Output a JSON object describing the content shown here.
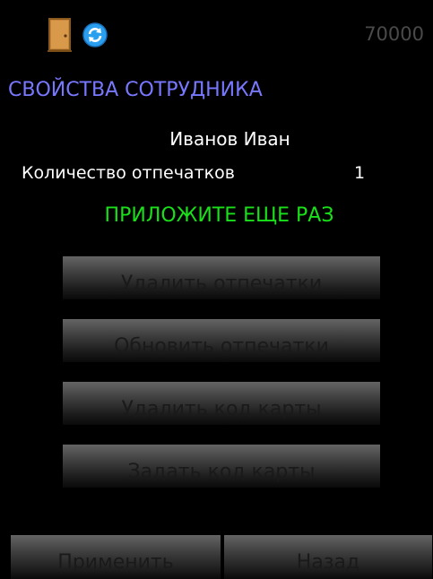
{
  "header": {
    "icons": [
      "door-icon",
      "sync-icon"
    ],
    "counter": "70000"
  },
  "title": "СВОЙСТВА СОТРУДНИКА",
  "employee": {
    "name": "Иванов Иван",
    "fingerprints_label": "Количество отпечатков",
    "fingerprints_count": "1"
  },
  "status": "ПРИЛОЖИТЕ ЕЩЕ РАЗ",
  "actions": {
    "delete_prints": "Удалить отпечатки",
    "update_prints": "Обновить отпечатки",
    "delete_card": "Удалить код карты",
    "set_card": "Задать код карты"
  },
  "footer": {
    "apply": "Применить",
    "back": "Назад"
  },
  "colors": {
    "background": "#000000",
    "title": "#7878ff",
    "status": "#19e019",
    "text": "#ffffff",
    "button_text": "#1a1a1a"
  }
}
